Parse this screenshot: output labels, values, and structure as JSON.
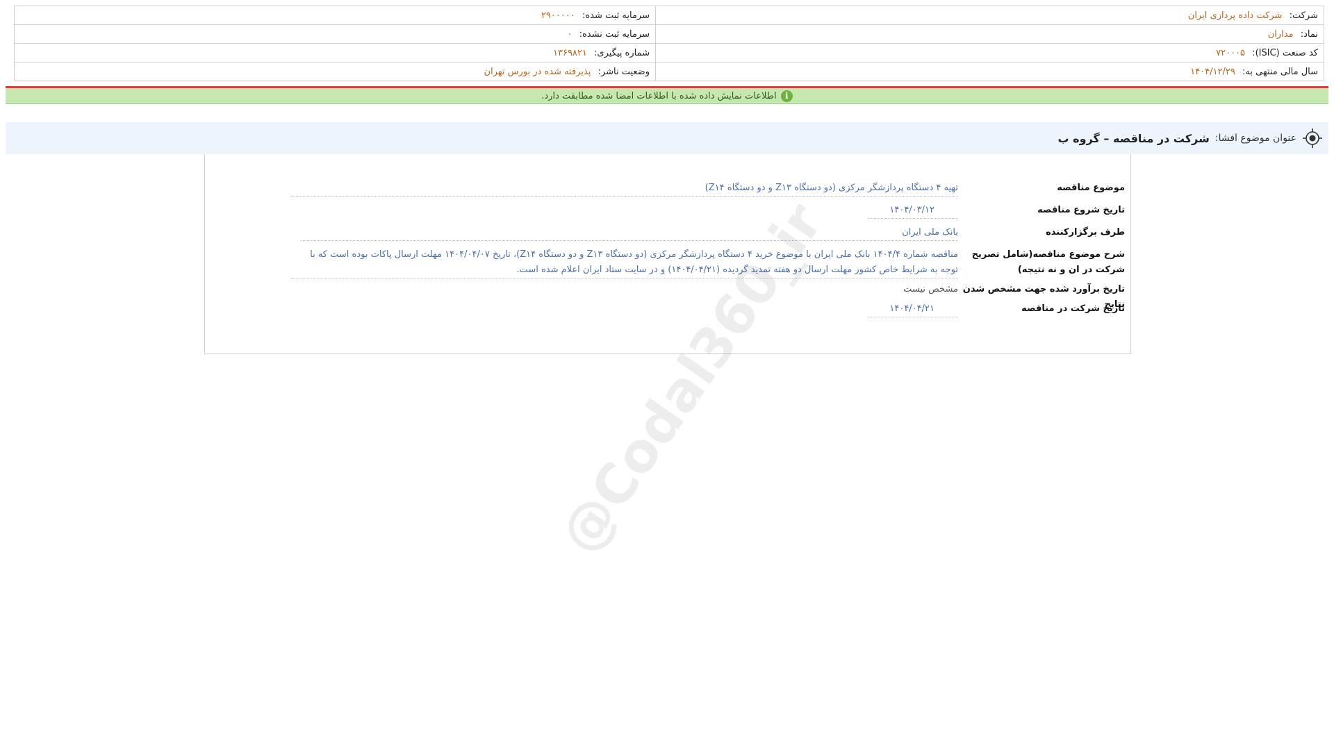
{
  "header": {
    "company_label": "شرکت:",
    "company_value": "شرکت داده پردازی ایران",
    "registered_capital_label": "سرمایه ثبت شده:",
    "registered_capital_value": "۲۹۰۰۰۰۰",
    "symbol_label": "نماد:",
    "symbol_value": "مداران",
    "unregistered_capital_label": "سرمایه ثبت نشده:",
    "unregistered_capital_value": "۰",
    "isic_label": "کد صنعت (ISIC):",
    "isic_value": "۷۲۰۰۰۵",
    "tracking_label": "شماره پیگیری:",
    "tracking_value": "۱۳۶۹۸۲۱",
    "fiscal_year_label": "سال مالی منتهی به:",
    "fiscal_year_value": "۱۴۰۴/۱۲/۲۹",
    "publisher_status_label": "وضعیت ناشر:",
    "publisher_status_value": "پذیرفته شده در بورس تهران"
  },
  "notice": {
    "text": "اطلاعات نمایش داده شده با اطلاعات امضا شده مطابقت دارد.",
    "icon": "info-icon"
  },
  "subject": {
    "label": "عنوان موضوع افشا:",
    "value": "شرکت در مناقصه – گروه ب"
  },
  "details": {
    "tender_subject_label": "موضوع مناقصه",
    "tender_subject_value": "تهیه ۴ دستگاه پردازشگر مرکزی (دو دستگاه Z۱۳ و دو دستگاه Z۱۴)",
    "start_date_label": "تاریخ شروع مناقصه",
    "start_date_value": "۱۴۰۴/۰۳/۱۲",
    "organizer_label": "طرف برگزارکننده",
    "organizer_value": "بانک ملی ایران",
    "description_label": "شرح موضوع مناقصه(شامل تصریح شرکت در ان و نه نتیجه)",
    "description_value": "مناقصه شماره ۱۴۰۴/۴ بانک ملی ایران با موضوع خرید ۴ دستگاه پردازشگر مرکزی (دو دستگاه Z۱۳ و دو دستگاه Z۱۴)، تاریخ ۱۴۰۴/۰۴/۰۷ مهلت ارسال پاکات بوده است که با توجه به شرایط خاص کشور مهلت ارسال دو هفته تمدید گردیده (۱۴۰۴/۰۴/۲۱) و در سایت ستاد ایران اعلام شده است.",
    "estimated_date_label": "تاریخ برآورد شده جهت مشخص شدن نتایج",
    "estimated_date_value": "مشخص نیست",
    "participation_date_label": "تاریخ شرکت در مناقصه",
    "participation_date_value": "۱۴۰۴/۰۴/۲۱"
  },
  "watermark": "@Codal360_ir"
}
